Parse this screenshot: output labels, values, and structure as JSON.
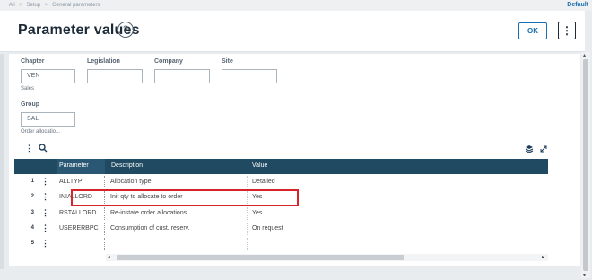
{
  "breadcrumb": [
    "All",
    "Setup",
    "General parameters"
  ],
  "breadcrumb_sep": ">",
  "top_right": "Default",
  "page_title": "Parameter values",
  "help_glyph": "?",
  "ok_label": "OK",
  "more_glyph": "⋮",
  "fields": {
    "chapter": {
      "label": "Chapter",
      "value": "VEN",
      "sub": "Sales"
    },
    "legislation": {
      "label": "Legislation",
      "value": ""
    },
    "company": {
      "label": "Company",
      "value": ""
    },
    "site": {
      "label": "Site",
      "value": ""
    },
    "group": {
      "label": "Group",
      "value": "SAL",
      "sub": "Order allocatio..."
    }
  },
  "grid": {
    "toolbar_more": "⋮",
    "columns": {
      "parameter": "Parameter",
      "description": "Description",
      "value": "Value"
    },
    "rows": [
      {
        "num": "1",
        "parameter": "ALLTYP",
        "description": "Allocation type",
        "value": "Detailed"
      },
      {
        "num": "2",
        "parameter": "INIALLORD",
        "description": "Init qty to allocate to order",
        "value": "Yes"
      },
      {
        "num": "3",
        "parameter": "RSTALLORD",
        "description": "Re-instate order allocations",
        "value": "Yes"
      },
      {
        "num": "4",
        "parameter": "USERERBPC",
        "description": "Consumption of cust. reserv.",
        "value": "On request"
      },
      {
        "num": "5",
        "parameter": "",
        "description": "",
        "value": ""
      }
    ]
  },
  "icons": {
    "search": "search-icon",
    "layers": "layers-icon",
    "expand": "expand-icon"
  },
  "colors": {
    "header_bg": "#1f4a62",
    "accent": "#1a6fb0",
    "highlight": "#d8232a"
  }
}
